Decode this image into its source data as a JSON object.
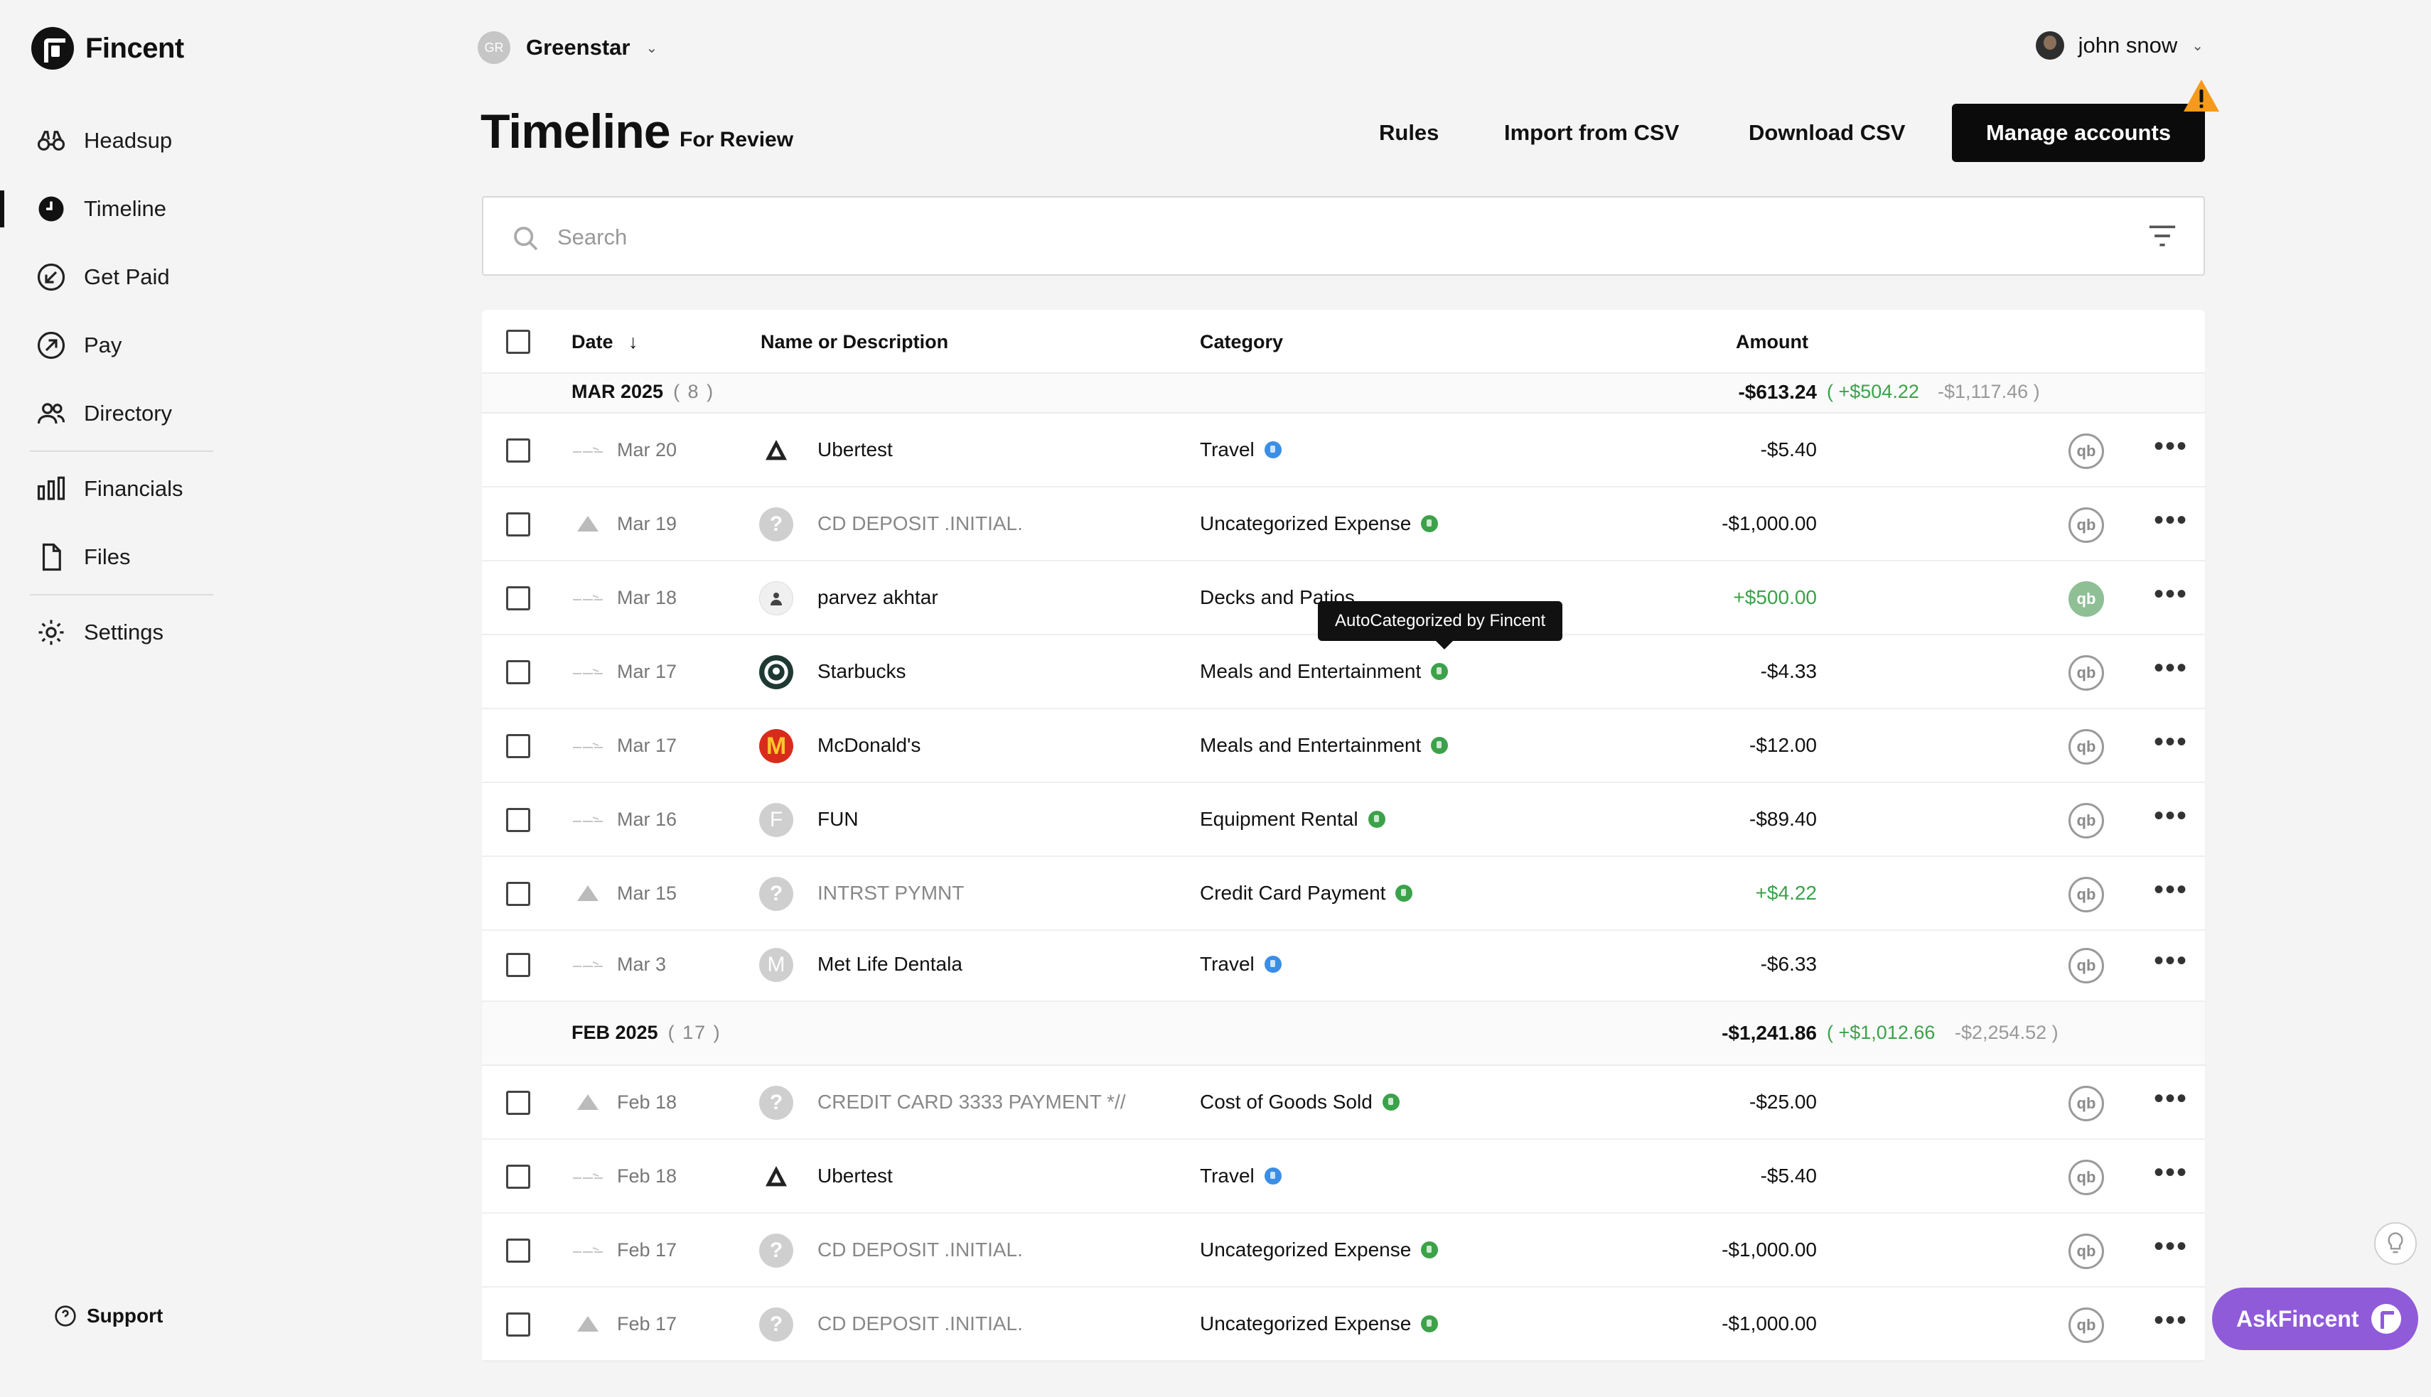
{
  "brand": {
    "name": "Fincent"
  },
  "nav": {
    "items": [
      {
        "label": "Headsup"
      },
      {
        "label": "Timeline"
      },
      {
        "label": "Get Paid"
      },
      {
        "label": "Pay"
      },
      {
        "label": "Directory"
      },
      {
        "label": "Financials"
      },
      {
        "label": "Files"
      },
      {
        "label": "Settings"
      }
    ],
    "active": "Timeline"
  },
  "support": {
    "label": "Support"
  },
  "org": {
    "initials": "GR",
    "name": "Greenstar"
  },
  "user": {
    "name": "john snow"
  },
  "header": {
    "title": "Timeline",
    "subtitle": "For Review",
    "rules_label": "Rules",
    "import_label": "Import from CSV",
    "download_label": "Download CSV",
    "manage_label": "Manage accounts"
  },
  "search": {
    "placeholder": "Search",
    "value": ""
  },
  "table": {
    "columns": {
      "date": "Date",
      "name": "Name or Description",
      "category": "Category",
      "amount": "Amount"
    },
    "groups": [
      {
        "label": "MAR 2025",
        "count": "( 8 )",
        "total": "-$613.24",
        "inflow": "( +$504.22",
        "outflow": "-$1,117.46 )"
      },
      {
        "label": "FEB 2025",
        "count": "( 17 )",
        "total": "-$1,241.86",
        "inflow": "( +$1,012.66",
        "outflow": "-$2,254.52 )"
      }
    ],
    "rows": [
      {
        "date": "Mar 20",
        "name": "Ubertest",
        "category": "Travel",
        "amount": "-$5.40",
        "icon": "uber-icon",
        "dot": "blue"
      },
      {
        "date": "Mar 19",
        "name": "CD DEPOSIT .INITIAL.",
        "category": "Uncategorized Expense",
        "amount": "-$1,000.00",
        "icon": "question-icon",
        "dot": "green"
      },
      {
        "date": "Mar 18",
        "name": "parvez akhtar",
        "category": "Decks and Patios",
        "amount": "+$500.00",
        "icon": "person-icon",
        "dot": ""
      },
      {
        "date": "Mar 17",
        "name": "Starbucks",
        "category": "Meals and Entertainment",
        "amount": "-$4.33",
        "icon": "starbucks-icon",
        "dot": "green"
      },
      {
        "date": "Mar 17",
        "name": "McDonald's",
        "category": "Meals and Entertainment",
        "amount": "-$12.00",
        "icon": "mcdonalds-icon",
        "dot": "green"
      },
      {
        "date": "Mar 16",
        "name": "FUN",
        "category": "Equipment Rental",
        "amount": "-$89.40",
        "icon": "letter-f-icon",
        "dot": "green"
      },
      {
        "date": "Mar 15",
        "name": "INTRST PYMNT",
        "category": "Credit Card Payment",
        "amount": "+$4.22",
        "icon": "question-icon",
        "dot": "green"
      },
      {
        "date": "Mar 3",
        "name": "Met Life Dentala",
        "category": "Travel",
        "amount": "-$6.33",
        "icon": "letter-m-icon",
        "dot": "blue"
      },
      {
        "date": "Feb 18",
        "name": "CREDIT CARD 3333 PAYMENT *//",
        "category": "Cost of Goods Sold",
        "amount": "-$25.00",
        "icon": "question-icon",
        "dot": "green"
      },
      {
        "date": "Feb 18",
        "name": "Ubertest",
        "category": "Travel",
        "amount": "-$5.40",
        "icon": "uber-icon",
        "dot": "blue"
      },
      {
        "date": "Feb 17",
        "name": "CD DEPOSIT .INITIAL.",
        "category": "Uncategorized Expense",
        "amount": "-$1,000.00",
        "icon": "question-icon",
        "dot": "green"
      },
      {
        "date": "Feb 17",
        "name": "CD DEPOSIT .INITIAL.",
        "category": "Uncategorized Expense",
        "amount": "-$1,000.00",
        "icon": "question-icon",
        "dot": "green"
      }
    ],
    "qb_label": "qb",
    "more_label": "•••"
  },
  "tooltip": {
    "text": "AutoCategorized by Fincent"
  },
  "ask": {
    "label": "AskFincent"
  },
  "colors": {
    "accent": "#0b0b0b",
    "positive": "#3ca24a",
    "ask": "#8f5bd9",
    "warning": "#f59a1b"
  }
}
